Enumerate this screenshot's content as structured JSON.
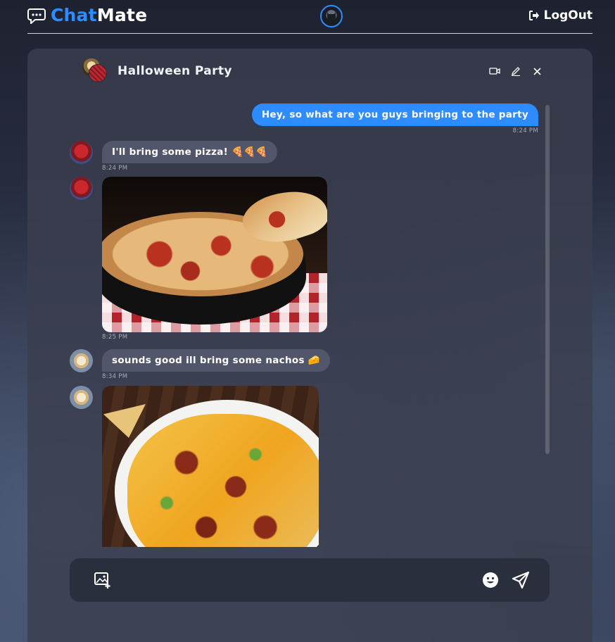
{
  "app": {
    "brand_part1": "Chat",
    "brand_part2": "Mate",
    "logout_label": "LogOut"
  },
  "chat": {
    "title": "Halloween Party"
  },
  "messages": [
    {
      "direction": "out",
      "text": "Hey, so what are you guys bringing to the party",
      "time": "8:24 PM"
    },
    {
      "direction": "in",
      "sender": "spiderman",
      "text": "I'll bring some pizza! 🍕🍕🍕",
      "time": "8:24 PM"
    },
    {
      "direction": "in",
      "sender": "spiderman",
      "image": "pizza",
      "time": "8:25 PM"
    },
    {
      "direction": "in",
      "sender": "dog",
      "text": "sounds good ill bring some nachos 🧀",
      "time": "8:34 PM"
    },
    {
      "direction": "in",
      "sender": "dog",
      "image": "nachos"
    }
  ],
  "composer": {
    "placeholder": ""
  },
  "colors": {
    "accent": "#2d8cff",
    "panel": "#3a3e4e",
    "incoming_bubble": "#52566a",
    "outgoing_bubble": "#2d8cff"
  },
  "icons": {
    "logo": "chat-bubble-icon",
    "logout": "logout-icon",
    "video": "video-camera-icon",
    "edit": "pencil-icon",
    "close": "close-icon",
    "add_image": "add-image-icon",
    "emoji": "smiley-icon",
    "send": "send-icon"
  }
}
